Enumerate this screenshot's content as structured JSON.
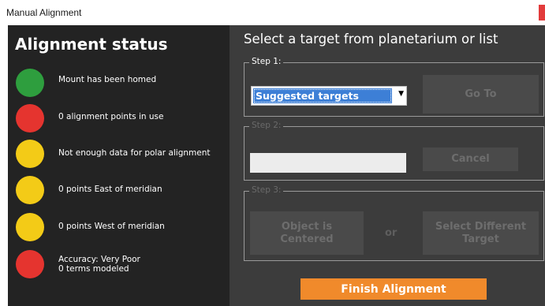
{
  "window": {
    "title": "Manual Alignment"
  },
  "alignment_status": {
    "title": "Alignment status",
    "items": [
      {
        "label": "Mount has been homed",
        "status": "green",
        "color": "#2e9e3e"
      },
      {
        "label": "0 alignment points in use",
        "status": "red",
        "color": "#e5342f"
      },
      {
        "label": "Not enough data for polar alignment",
        "status": "yellow",
        "color": "#f3cb17"
      },
      {
        "label": "0 points East of meridian",
        "status": "yellow",
        "color": "#f3cb17"
      },
      {
        "label": "0 points West of meridian",
        "status": "yellow",
        "color": "#f3cb17"
      },
      {
        "label": "Accuracy: Very Poor\n0 terms modeled",
        "status": "red",
        "color": "#e5342f"
      }
    ]
  },
  "target_panel": {
    "title": "Select a target from planetarium or list",
    "step1": {
      "label": "Step 1:",
      "select_value": "Suggested targets",
      "goto_label": "Go To"
    },
    "step2": {
      "label": "Step 2:",
      "field_value": "",
      "cancel_label": "Cancel"
    },
    "step3": {
      "label": "Step 3:",
      "centered_label": "Object is\nCentered",
      "or_label": "or",
      "select_different_label": "Select Different\nTarget"
    },
    "finish_label": "Finish Alignment"
  },
  "colors": {
    "left_panel_bg": "#232323",
    "right_panel_bg": "#3c3c3c",
    "accent_orange": "#f08a2b",
    "select_highlight": "#3d7fd6"
  }
}
